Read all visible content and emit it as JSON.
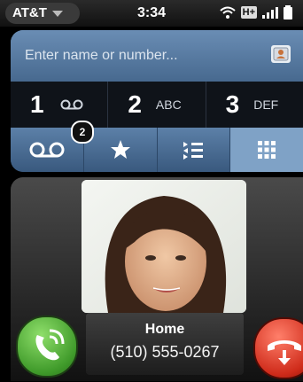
{
  "status_bar": {
    "carrier": "AT&T",
    "time": "3:34",
    "network": "H+"
  },
  "search": {
    "placeholder": "Enter name or number..."
  },
  "keypad": [
    {
      "number": "1",
      "letters": ""
    },
    {
      "number": "2",
      "letters": "ABC"
    },
    {
      "number": "3",
      "letters": "DEF"
    }
  ],
  "tabs": [
    {
      "icon": "voicemail-icon",
      "badge": "2"
    },
    {
      "icon": "star-icon"
    },
    {
      "icon": "call-log-icon"
    },
    {
      "icon": "keypad-grid-icon",
      "active": true
    }
  ],
  "incoming_call": {
    "type": "Home",
    "number": "(510) 555-0267"
  },
  "colors": {
    "panel": "#4a6d94",
    "answer": "#4caf32",
    "decline": "#d8301f"
  }
}
